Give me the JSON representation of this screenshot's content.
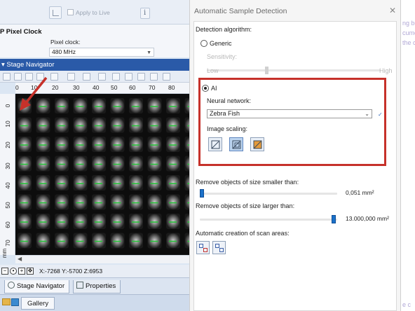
{
  "toolbar": {
    "apply_to_live": "Apply to Live"
  },
  "pixel_clock": {
    "title": "P Pixel Clock",
    "label": "Pixel clock:",
    "value": "480 MHz"
  },
  "stage_navigator": {
    "title": "Stage Navigator",
    "x_ticks": [
      "0",
      "10",
      "20",
      "30",
      "40",
      "50",
      "60",
      "70",
      "80"
    ],
    "y_ticks": [
      "0",
      "10",
      "20",
      "30",
      "40",
      "50",
      "60",
      "70"
    ],
    "y_unit": "mm",
    "coords": "X:-7268 Y:-5700 Z:6953"
  },
  "bottom_tabs": {
    "stage_navigator": "Stage Navigator",
    "properties": "Properties",
    "gallery": "Gallery"
  },
  "background_text": [
    "ng bo",
    "cume",
    "the c",
    "e c"
  ],
  "dialog": {
    "title": "Automatic Sample Detection",
    "detection_algorithm_label": "Detection algorithm:",
    "generic_label": "Generic",
    "sensitivity_label": "Sensitivity:",
    "low_label": "Low",
    "high_label": "High",
    "ai_label": "AI",
    "neural_network_label": "Neural network:",
    "neural_network_value": "Zebra Fish",
    "image_scaling_label": "Image scaling:",
    "remove_smaller_label": "Remove objects of size smaller than:",
    "remove_smaller_value": "0,051 mm²",
    "remove_larger_label": "Remove objects of size larger than:",
    "remove_larger_value": "13.000,000 mm²",
    "auto_scan_label": "Automatic creation of scan areas:",
    "selected_algorithm": "AI",
    "selected_scaling": "fit"
  },
  "colors": {
    "highlight_box": "#c6312a",
    "title_bar": "#2a5aa8",
    "slider_thumb": "#1b71c9",
    "detection_marker": "#27c33a"
  }
}
